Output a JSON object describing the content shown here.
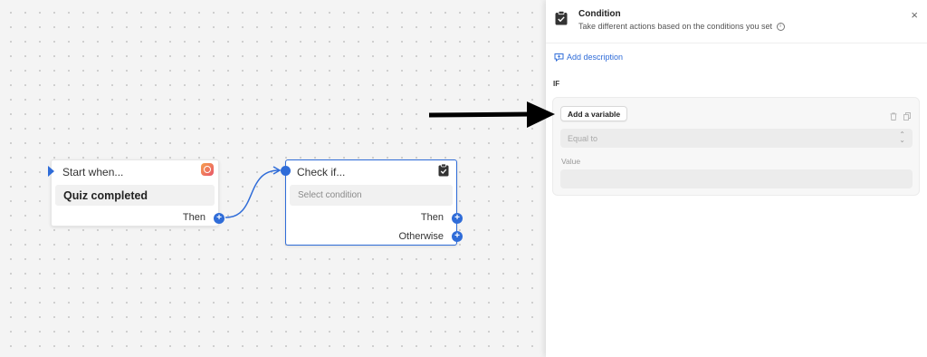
{
  "canvas": {
    "start_node": {
      "title": "Start when...",
      "event": "Quiz completed",
      "output_label": "Then",
      "icon": "quiz-app-icon",
      "add_symbol": "+"
    },
    "check_node": {
      "title": "Check if...",
      "placeholder": "Select condition",
      "then_label": "Then",
      "otherwise_label": "Otherwise",
      "icon": "clipboard-check-icon",
      "add_symbol": "+"
    }
  },
  "panel": {
    "title": "Condition",
    "subtitle": "Take different actions based on the conditions you set",
    "info_icon": "i",
    "close_symbol": "×",
    "add_description": "Add description",
    "if_label": "IF",
    "condition": {
      "add_variable": "Add a variable",
      "operator": "Equal to",
      "value_label": "Value",
      "value": ""
    }
  },
  "colors": {
    "accent": "#2f6cd8",
    "canvas_bg": "#f4f4f4",
    "panel_bg": "#ffffff"
  }
}
